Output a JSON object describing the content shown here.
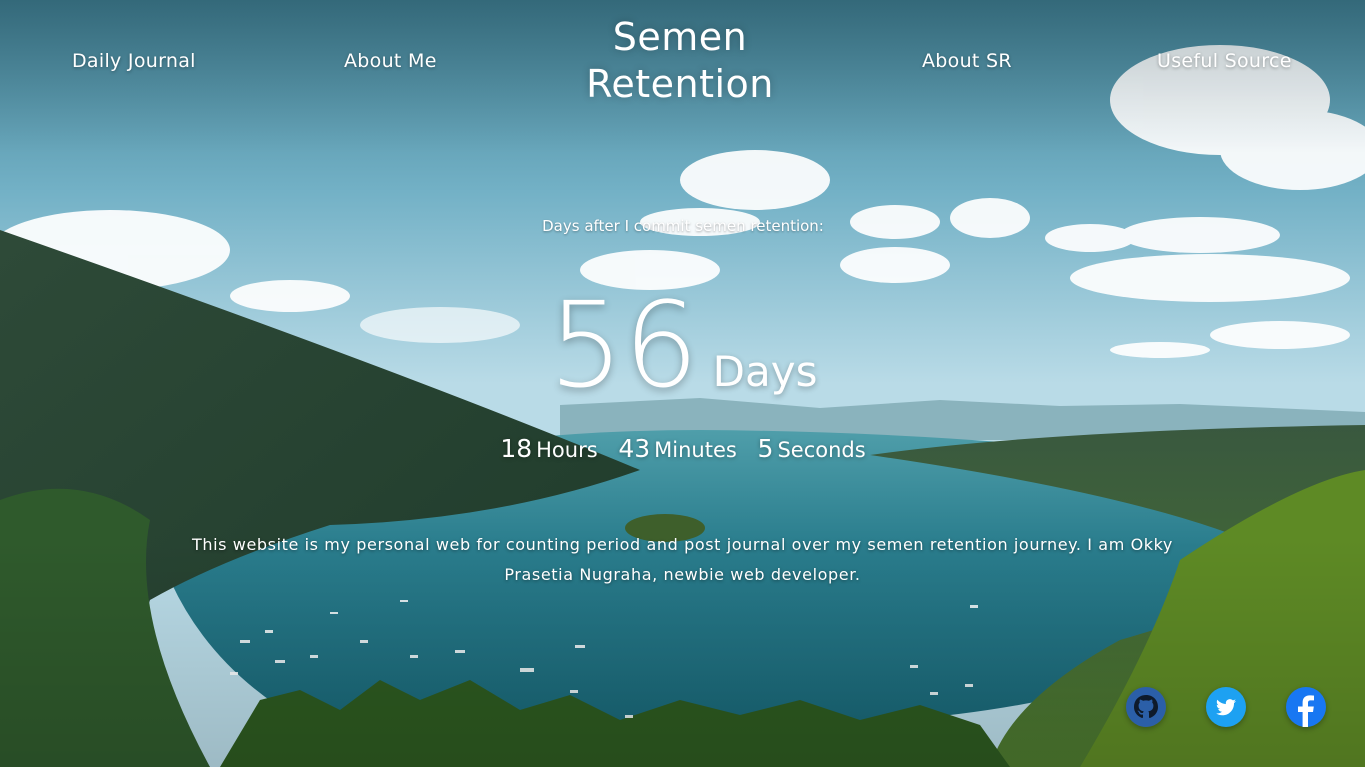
{
  "nav": {
    "left": [
      {
        "label": "Daily Journal"
      },
      {
        "label": "About Me"
      }
    ],
    "brand_line1": "Semen",
    "brand_line2": "Retention",
    "right": [
      {
        "label": "About SR"
      },
      {
        "label": "Useful Source"
      }
    ]
  },
  "counter": {
    "subtitle": "Days after I commit semen retention:",
    "days": "56",
    "days_label": "Days",
    "hours": "18",
    "hours_label": "Hours",
    "minutes": "43",
    "minutes_label": "Minutes",
    "seconds": "5",
    "seconds_label": "Seconds"
  },
  "intro": {
    "text": "This website is my personal web for counting period and post journal over my semen retention journey. I am Okky Prasetia Nugraha, newbie web developer."
  },
  "social": [
    {
      "icon": "github-icon",
      "color": "#2b5fa8"
    },
    {
      "icon": "twitter-icon",
      "color": "#1da1f2"
    },
    {
      "icon": "facebook-icon",
      "color": "#1877f2"
    }
  ]
}
